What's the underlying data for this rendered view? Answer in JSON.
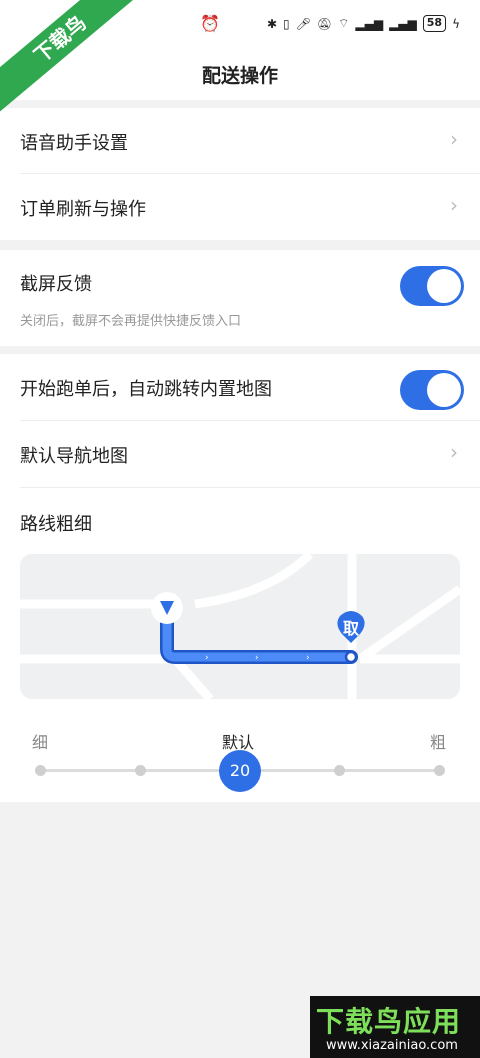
{
  "status_bar": {
    "battery": "58",
    "icons": [
      "alarm-icon",
      "bluetooth-icon",
      "vibrate-icon",
      "mic-icon",
      "mute-icon",
      "wifi-icon",
      "signal-icon",
      "signal-icon",
      "battery-icon",
      "charging-icon"
    ]
  },
  "watermark": {
    "corner_text": "下载鸟",
    "brand_text": "下载鸟应用",
    "brand_url": "www.xiazainiao.com"
  },
  "nav": {
    "title": "配送操作"
  },
  "section1": {
    "items": [
      {
        "label": "语音助手设置"
      },
      {
        "label": "订单刷新与操作"
      }
    ]
  },
  "section2": {
    "screenshot_feedback": {
      "label": "截屏反馈",
      "enabled": true,
      "description": "关闭后，截屏不会再提供快捷反馈入口"
    }
  },
  "section3": {
    "auto_jump": {
      "label": "开始跑单后，自动跳转内置地图",
      "enabled": true
    },
    "default_nav": {
      "label": "默认导航地图"
    },
    "route_width": {
      "label": "路线粗细",
      "pickup_marker": "取",
      "min_label": "细",
      "default_label": "默认",
      "max_label": "粗",
      "value": "20",
      "steps": 5,
      "selected_step": 2
    }
  },
  "colors": {
    "accent": "#2f6fe6",
    "background": "#f2f2f2"
  }
}
